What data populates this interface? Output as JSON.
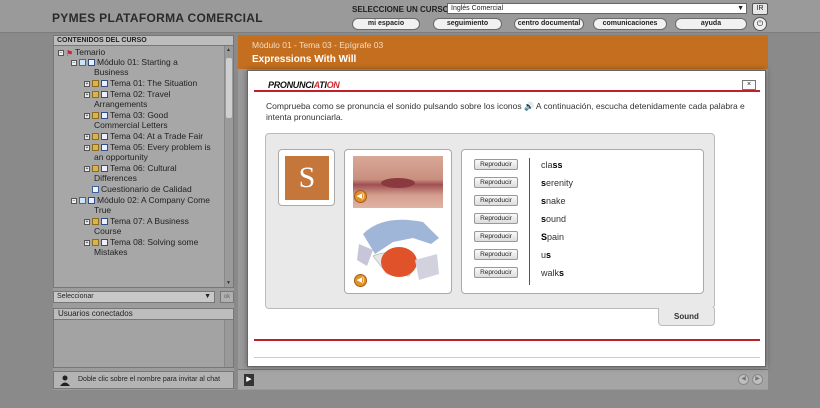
{
  "header": {
    "app_title": "PYMES PLATAFORMA COMERCIAL",
    "course_label": "SELECCIONE UN CURSO:",
    "course_value": "Inglés Comercial",
    "go_label": "IR",
    "nav": [
      "mi espacio",
      "seguimiento",
      "centro documental",
      "comunicaciones",
      "ayuda"
    ]
  },
  "sidebar": {
    "title": "CONTENIDOS DEL CURSO",
    "tree": [
      {
        "label": "Temario"
      },
      {
        "label": "Módulo 01: Starting a",
        "cont": "Business"
      },
      {
        "label": "Tema 01: The Situation"
      },
      {
        "label": "Tema 02: Travel",
        "cont": "Arrangements"
      },
      {
        "label": "Tema 03: Good",
        "cont": "Commercial Letters"
      },
      {
        "label": "Tema 04: At a Trade Fair"
      },
      {
        "label": "Tema 05: Every problem is",
        "cont": "an opportunity"
      },
      {
        "label": "Tema 06: Cultural",
        "cont": "Differences"
      },
      {
        "label": "Cuestionario de Calidad"
      },
      {
        "label": "Módulo 02: A Company Come",
        "cont": "True"
      },
      {
        "label": "Tema 07: A Business",
        "cont": "Course"
      },
      {
        "label": "Tema 08: Solving some",
        "cont": "Mistakes"
      }
    ],
    "select_value": "Seleccionar",
    "ok_label": "ok",
    "users_title": "Usuarios conectados",
    "footer_hint": "Doble clic sobre el nombre para invitar al chat"
  },
  "main": {
    "breadcrumb": "Módulo 01 - Tema 03 - Epígrafe 03",
    "lesson_title": "Expressions With Will"
  },
  "modal": {
    "logo_prefix": "PRONUNCI",
    "logo_highlight_1": "A",
    "logo_middle": "TI",
    "logo_highlight_2": "ON",
    "close_label": "×",
    "instructions_1": "Comprueba como se pronuncia el sonido pulsando sobre los iconos",
    "instructions_2": "A continuación, escucha detenidamente cada palabra e intenta pronunciarla.",
    "letter": "S",
    "play_label": "Reproducir",
    "words": [
      {
        "pre": "cla",
        "hl": "ss",
        "post": ""
      },
      {
        "pre": "",
        "hl": "s",
        "post": "erenity"
      },
      {
        "pre": "",
        "hl": "s",
        "post": "nake"
      },
      {
        "pre": "",
        "hl": "s",
        "post": "ound"
      },
      {
        "pre": "",
        "hl": "S",
        "post": "pain"
      },
      {
        "pre": "u",
        "hl": "s",
        "post": ""
      },
      {
        "pre": "walk",
        "hl": "s",
        "post": ""
      }
    ],
    "tab_label": "Sound"
  },
  "colors": {
    "accent_orange": "#c46f1f",
    "brand_red": "#c0202a",
    "letter_tile": "#c4763b"
  },
  "icons": {
    "speaker": "speaker-icon",
    "power": "power-icon",
    "person": "person-icon"
  }
}
